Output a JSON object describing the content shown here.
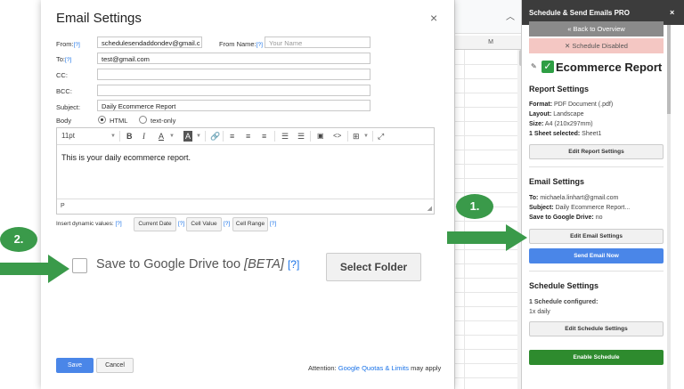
{
  "dialog": {
    "title": "Email Settings",
    "close": "×",
    "help": "[?]",
    "from_label": "From:",
    "from_value": "schedulesendaddondev@gmail.c",
    "from_name_label": "From Name:",
    "from_name_placeholder": "Your Name",
    "to_label": "To:",
    "to_value": "test@gmail.com",
    "cc_label": "CC:",
    "bcc_label": "BCC:",
    "subject_label": "Subject:",
    "subject_value": "Daily Ecommerce Report",
    "body_label": "Body",
    "html_option": "HTML",
    "text_option": "text-only",
    "editor": {
      "font_size": "11pt",
      "bold": "B",
      "italic": "I",
      "font_color": "A",
      "highlight": "A",
      "body_text": "This is your daily ecommerce report.",
      "footer": "P"
    },
    "dynamic_label": "Insert dynamic values:",
    "current_date_btn": "Current Date",
    "cell_value_btn": "Cell Value",
    "cell_range_btn": "Cell Range",
    "drive_label": "Save to Google Drive too",
    "drive_beta": "[BETA]",
    "drive_help": "[?]",
    "select_folder": "Select Folder",
    "save": "Save",
    "cancel": "Cancel",
    "attention_prefix": "Attention:",
    "attention_link": "Google Quotas & Limits",
    "attention_suffix": "may apply"
  },
  "sheet": {
    "column_header": "M"
  },
  "sidebar": {
    "title": "Schedule & Send Emails PRO",
    "close": "×",
    "back": "« Back to Overview",
    "disabled": "✕ Schedule Disabled",
    "report_name": "Ecommerce Report",
    "report_settings_title": "Report Settings",
    "format_label": "Format:",
    "format_value": "PDF Document (.pdf)",
    "layout_label": "Layout:",
    "layout_value": "Landscape",
    "size_label": "Size:",
    "size_value": "A4 (210x297mm)",
    "sheet_label": "1 Sheet selected:",
    "sheet_value": "Sheet1",
    "edit_report_btn": "Edit Report Settings",
    "email_settings_title": "Email Settings",
    "to_label": "To:",
    "to_value": "michaela.linhart@gmail.com",
    "subject_label": "Subject:",
    "subject_value": "Daily Ecommerce Report...",
    "drive_label": "Save to Google Drive:",
    "drive_value": "no",
    "edit_email_btn": "Edit Email Settings",
    "send_now_btn": "Send Email Now",
    "schedule_settings_title": "Schedule Settings",
    "schedule_configured": "1 Schedule configured:",
    "schedule_value": "1x daily",
    "edit_schedule_btn": "Edit Schedule Settings",
    "enable_schedule_btn": "Enable Schedule"
  },
  "annotations": {
    "step1": "1.",
    "step2": "2."
  },
  "colors": {
    "accent_green": "#3a9a4a",
    "button_blue": "#4a86e8",
    "enable_green": "#2e8b2e",
    "disabled_red": "#f4c7c3"
  }
}
